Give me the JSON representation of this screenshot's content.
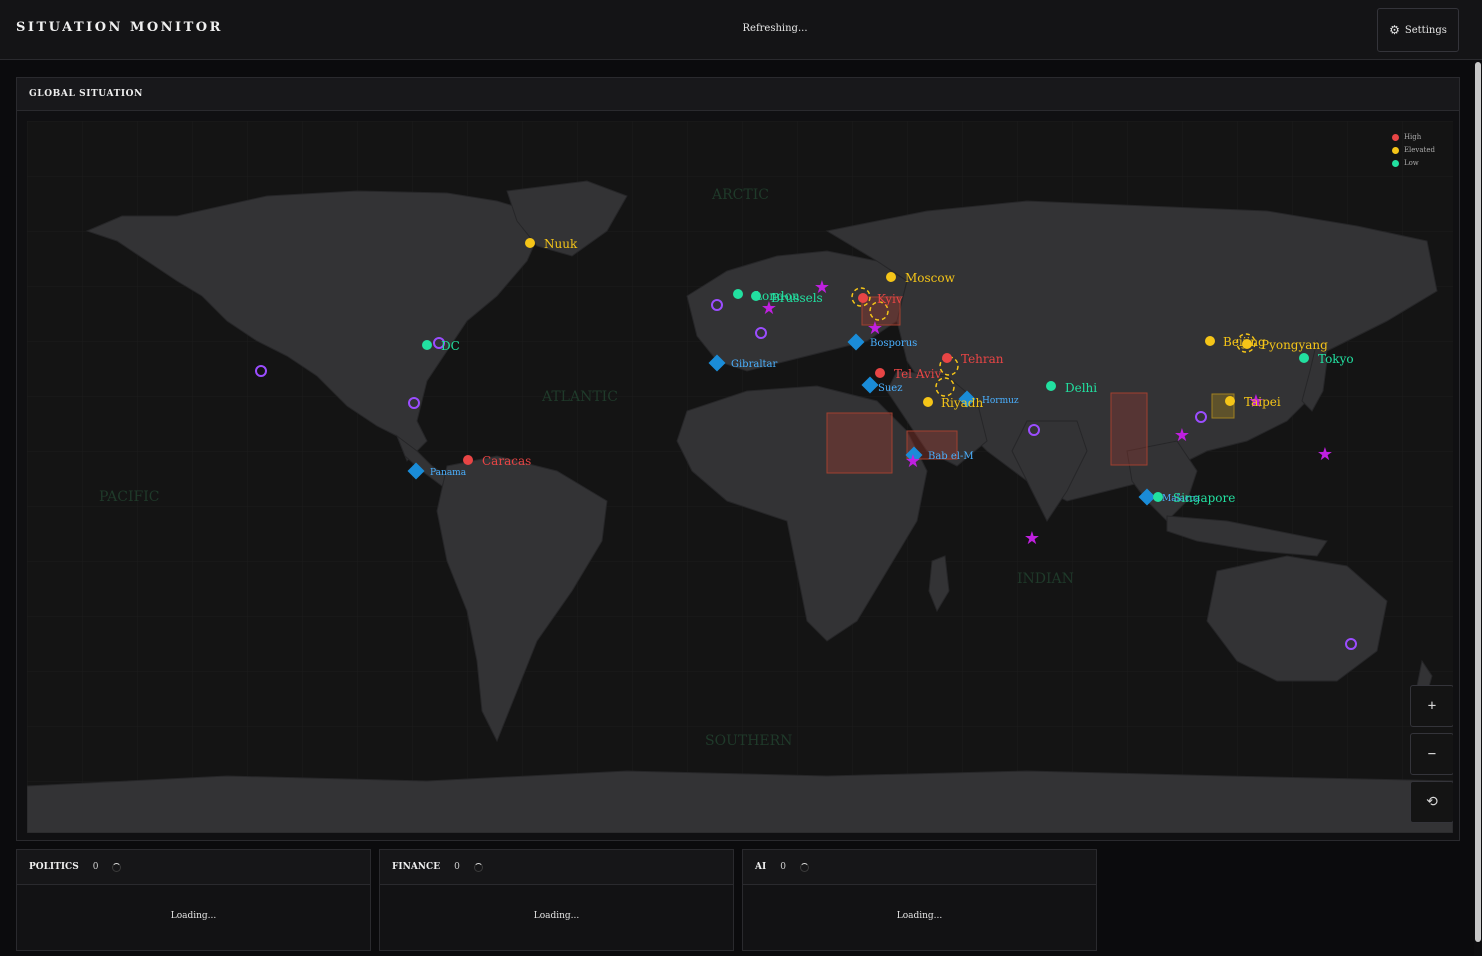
{
  "header": {
    "title": "SITUATION MONITOR",
    "status": "Refreshing...",
    "settings_label": "Settings"
  },
  "map_panel": {
    "title": "GLOBAL SITUATION",
    "legend": [
      {
        "label": "High",
        "color": "#e84545"
      },
      {
        "label": "Elevated",
        "color": "#f5c518"
      },
      {
        "label": "Low",
        "color": "#22e0a0"
      }
    ],
    "ocean_labels": [
      "ARCTIC",
      "ATLANTIC",
      "PACIFIC",
      "INDIAN",
      "SOUTHERN"
    ],
    "cities": [
      {
        "name": "Nuuk",
        "level": "elevated"
      },
      {
        "name": "Moscow",
        "level": "elevated"
      },
      {
        "name": "London",
        "level": "low"
      },
      {
        "name": "Brussels",
        "level": "low"
      },
      {
        "name": "Kyiv",
        "level": "high"
      },
      {
        "name": "DC",
        "level": "low"
      },
      {
        "name": "Tehran",
        "level": "high"
      },
      {
        "name": "Tel Aviv",
        "level": "high"
      },
      {
        "name": "Riyadh",
        "level": "elevated"
      },
      {
        "name": "Delhi",
        "level": "low"
      },
      {
        "name": "Beijing",
        "level": "elevated"
      },
      {
        "name": "Pyongyang",
        "level": "elevated"
      },
      {
        "name": "Tokyo",
        "level": "low"
      },
      {
        "name": "Taipei",
        "level": "elevated"
      },
      {
        "name": "Singapore",
        "level": "low"
      },
      {
        "name": "Caracas",
        "level": "high"
      }
    ],
    "chokepoints": [
      "Gibraltar",
      "Bosporus",
      "Suez",
      "Hormuz",
      "Bab el-M",
      "Malacca",
      "Panama"
    ],
    "zoom_controls": {
      "zoom_in": "+",
      "zoom_out": "−",
      "reset": "⟲"
    },
    "colors": {
      "chokepoint": "#1a8cd8",
      "star": "#c020e0",
      "ring": "#9b4dff"
    }
  },
  "panels": [
    {
      "title": "POLITICS",
      "count": "0",
      "status": "Loading..."
    },
    {
      "title": "FINANCE",
      "count": "0",
      "status": "Loading..."
    },
    {
      "title": "AI",
      "count": "0",
      "status": "Loading..."
    }
  ]
}
